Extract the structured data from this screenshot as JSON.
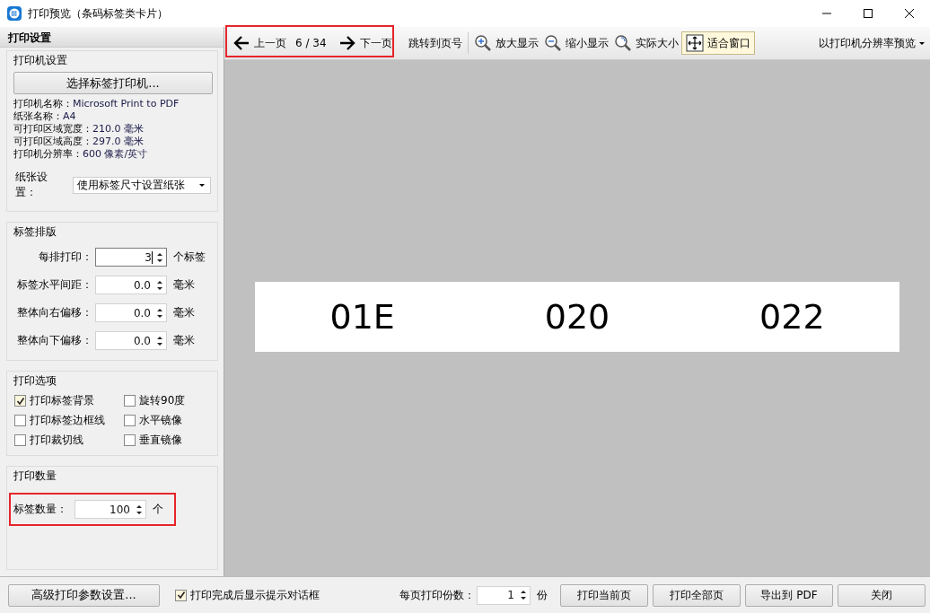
{
  "window": {
    "title": "打印预览（条码标签类卡片）"
  },
  "sidebar": {
    "title": "打印设置",
    "printer": {
      "title": "打印机设置",
      "button": "选择标签打印机...",
      "info": [
        {
          "label": "打印机名称：",
          "value": "Microsoft Print to PDF"
        },
        {
          "label": "纸张名称：",
          "value": "A4"
        },
        {
          "label": "可打印区域宽度：",
          "value": "210.0 毫米"
        },
        {
          "label": "可打印区域高度：",
          "value": "297.0 毫米"
        },
        {
          "label": "打印机分辨率：",
          "value": "600 像素/英寸"
        }
      ],
      "paper_label": "纸张设置：",
      "paper_value": "使用标签尺寸设置纸张"
    },
    "layout": {
      "title": "标签排版",
      "rows": [
        {
          "label": "每排打印：",
          "value": "3",
          "unit": "个标签",
          "focused": true
        },
        {
          "label": "标签水平间距：",
          "value": "0.0",
          "unit": "毫米",
          "focused": false
        },
        {
          "label": "整体向右偏移：",
          "value": "0.0",
          "unit": "毫米",
          "focused": false
        },
        {
          "label": "整体向下偏移：",
          "value": "0.0",
          "unit": "毫米",
          "focused": false
        }
      ]
    },
    "options": {
      "title": "打印选项",
      "items": [
        {
          "label": "打印标签背景",
          "checked": true
        },
        {
          "label": "旋转90度",
          "checked": false
        },
        {
          "label": "打印标签边框线",
          "checked": false
        },
        {
          "label": "水平镜像",
          "checked": false
        },
        {
          "label": "打印裁切线",
          "checked": false
        },
        {
          "label": "垂直镜像",
          "checked": false
        }
      ]
    },
    "quantity": {
      "title": "打印数量",
      "label": "标签数量：",
      "value": "100",
      "unit": "个",
      "highlighted": true
    }
  },
  "toolbar": {
    "nav": {
      "prev": "上一页",
      "page": "6 / 34",
      "next": "下一页",
      "highlighted": true
    },
    "tools": [
      {
        "kind": "jump",
        "label": "跳转到页号",
        "selected": false
      },
      {
        "kind": "zoom_in",
        "label": "放大显示",
        "selected": false
      },
      {
        "kind": "zoom_out",
        "label": "缩小显示",
        "selected": false
      },
      {
        "kind": "actual",
        "label": "实际大小",
        "selected": false
      },
      {
        "kind": "fit",
        "label": "适合窗口",
        "selected": true
      }
    ],
    "mode": "以打印机分辨率预览"
  },
  "preview": {
    "labels": [
      "01E",
      "020",
      "022"
    ]
  },
  "bottom": {
    "advanced": "高级打印参数设置...",
    "notify": {
      "label": "打印完成后显示提示对话框",
      "checked": true
    },
    "copies": {
      "label": "每页打印份数：",
      "value": "1",
      "unit": "份"
    },
    "buttons": [
      "打印当前页",
      "打印全部页",
      "导出到 PDF",
      "关闭"
    ]
  }
}
